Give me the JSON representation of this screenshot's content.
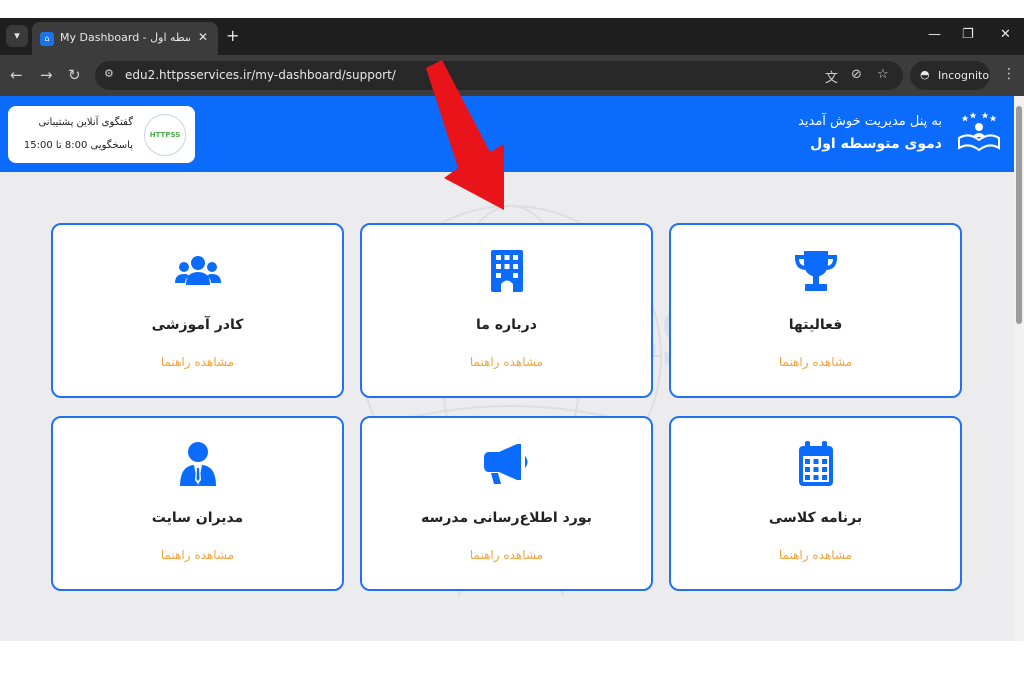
{
  "browser": {
    "tab_title": "My Dashboard - دموی متوسطه اول",
    "url": "edu2.httpsservices.ir/my-dashboard/support/",
    "incognito_label": "Incognito"
  },
  "header": {
    "support_title": "گفتگوی آنلاین پشتیبانی",
    "support_hours": "پاسخگویی 8:00 تا 15:00",
    "support_logo_text": "HTTPSS",
    "welcome_line1": "به پنل مدیریت خوش آمدید",
    "welcome_line2": "دموی متوسطه اول"
  },
  "watermark_text": "HTTPSS",
  "cards": [
    {
      "title": "کادر آموزشی",
      "link": "مشاهده راهنما",
      "icon": "users-group-icon"
    },
    {
      "title": "درباره ما",
      "link": "مشاهده راهنما",
      "icon": "building-icon"
    },
    {
      "title": "فعالیتها",
      "link": "مشاهده راهنما",
      "icon": "trophy-icon"
    },
    {
      "title": "مدیران سایت",
      "link": "مشاهده راهنما",
      "icon": "user-tie-icon"
    },
    {
      "title": "بورد اطلاع‌رسانی مدرسه",
      "link": "مشاهده راهنما",
      "icon": "megaphone-icon"
    },
    {
      "title": "برنامه کلاسی",
      "link": "مشاهده راهنما",
      "icon": "calendar-icon"
    }
  ],
  "colors": {
    "header_blue": "#0b6bfc",
    "card_border": "#2271f5",
    "link_orange": "#f2a33a",
    "arrow_red": "#e8141a"
  }
}
